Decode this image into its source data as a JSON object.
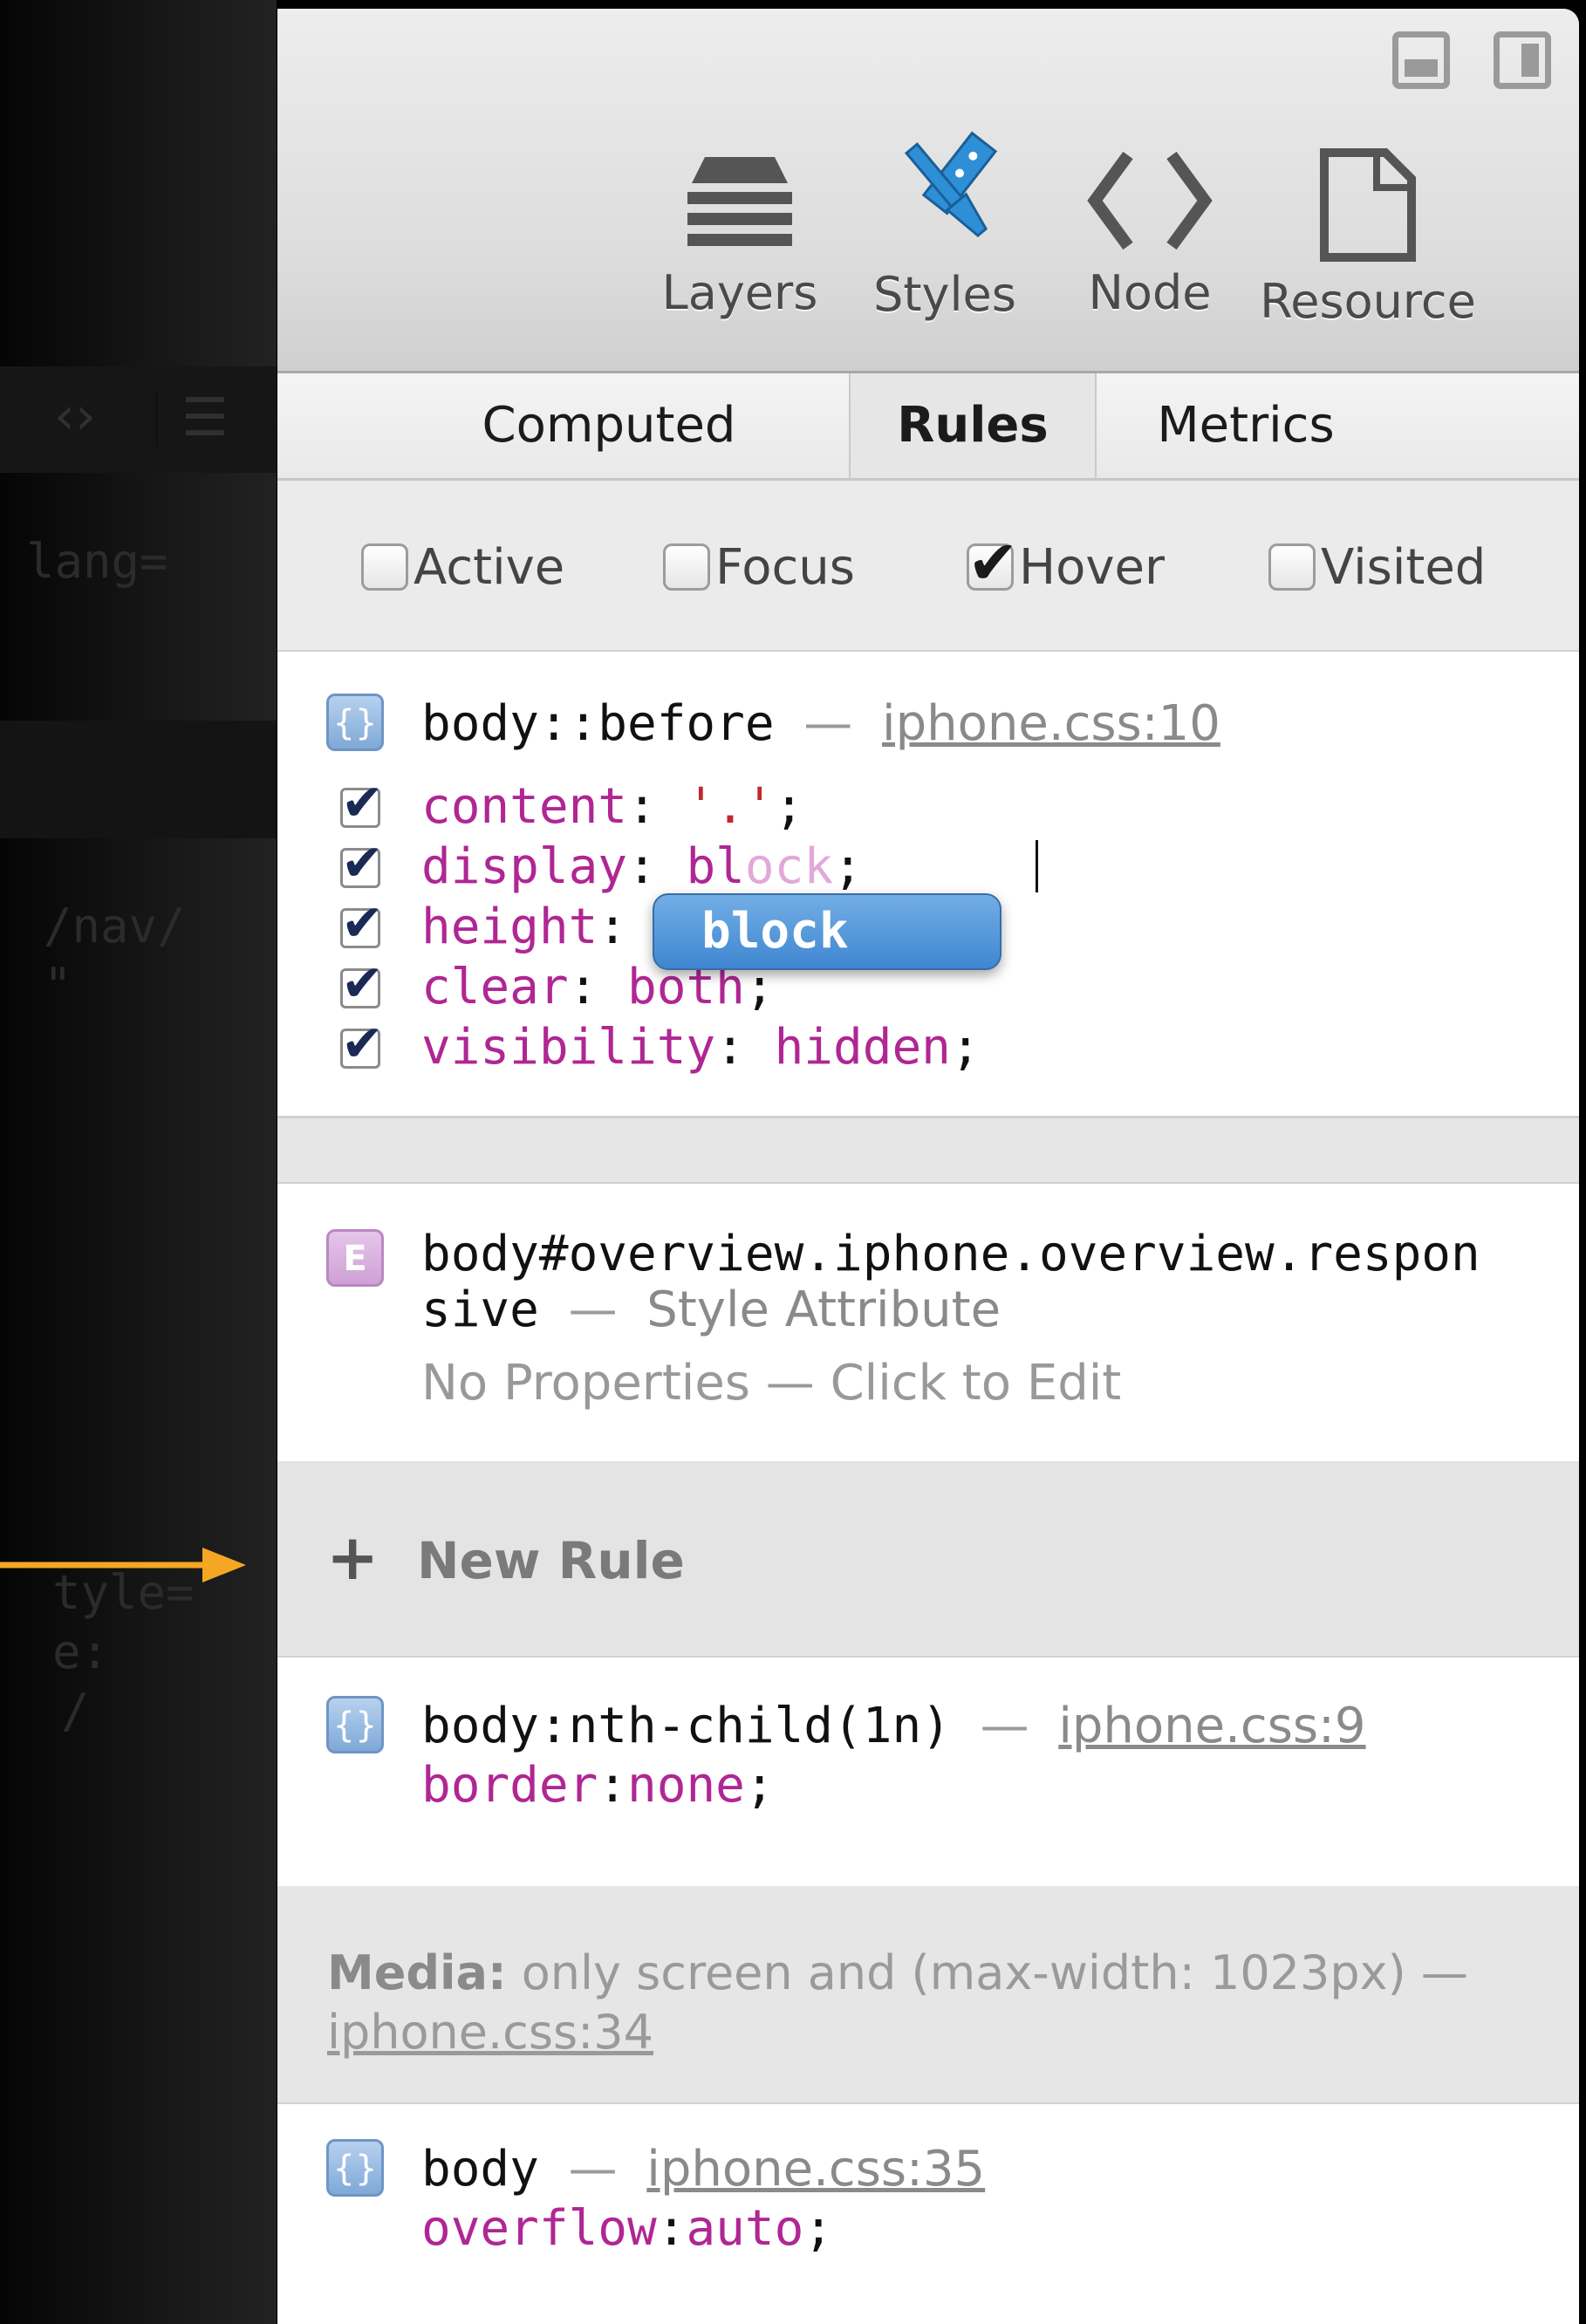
{
  "left_editor": {
    "fragments": [
      "lang=",
      "/nav/",
      "\"",
      "tyle=",
      "e:",
      "/"
    ]
  },
  "toolbar": {
    "tools": [
      {
        "label": "Layers",
        "icon": "layers-icon"
      },
      {
        "label": "Styles",
        "icon": "styles-brush-icon",
        "accent": "#2e8fd6"
      },
      {
        "label": "Node",
        "icon": "node-brackets-icon"
      },
      {
        "label": "Resource",
        "icon": "resource-document-icon"
      }
    ]
  },
  "tabs": [
    {
      "label": "Computed"
    },
    {
      "label": "Rules",
      "selected": true
    },
    {
      "label": "Metrics"
    }
  ],
  "pseudo_classes": [
    {
      "label": "Active",
      "checked": false
    },
    {
      "label": "Focus",
      "checked": false
    },
    {
      "label": "Hover",
      "checked": true
    },
    {
      "label": "Visited",
      "checked": false
    }
  ],
  "rules": [
    {
      "selector": "body::before",
      "separator": "—",
      "source": "iphone.css:10",
      "properties": [
        {
          "name": "content",
          "value": "'.'"
        },
        {
          "name": "display",
          "typed": "bl",
          "completion_hint": "ock"
        },
        {
          "name": "height",
          "value": ""
        },
        {
          "name": "clear",
          "value": "both"
        },
        {
          "name": "visibility",
          "value": "hidden"
        }
      ],
      "autocomplete": "block"
    },
    {
      "selector_line1": "body#overview.iphone.overview.respon",
      "selector_line2": "sive",
      "separator": "—",
      "origin": "Style Attribute",
      "empty_text": "No Properties — Click to Edit",
      "icon_letter": "E"
    },
    {
      "selector": "body:nth-child(1n)",
      "separator": "—",
      "source": "iphone.css:9",
      "properties": [
        {
          "name": "border",
          "value": "none"
        }
      ]
    },
    {
      "selector": "body",
      "separator": "—",
      "source": "iphone.css:35",
      "properties": [
        {
          "name": "overflow",
          "value": "auto"
        }
      ]
    }
  ],
  "new_rule": {
    "label": "New Rule"
  },
  "media": {
    "label": "Media:",
    "query": "only screen and (max-width: 1023px) —",
    "source": "iphone.css:34"
  },
  "colors": {
    "arrow": "#f5a623",
    "property_name": "#b02693",
    "string_value": "#c1272d",
    "autocomplete": "#4a90d9"
  }
}
